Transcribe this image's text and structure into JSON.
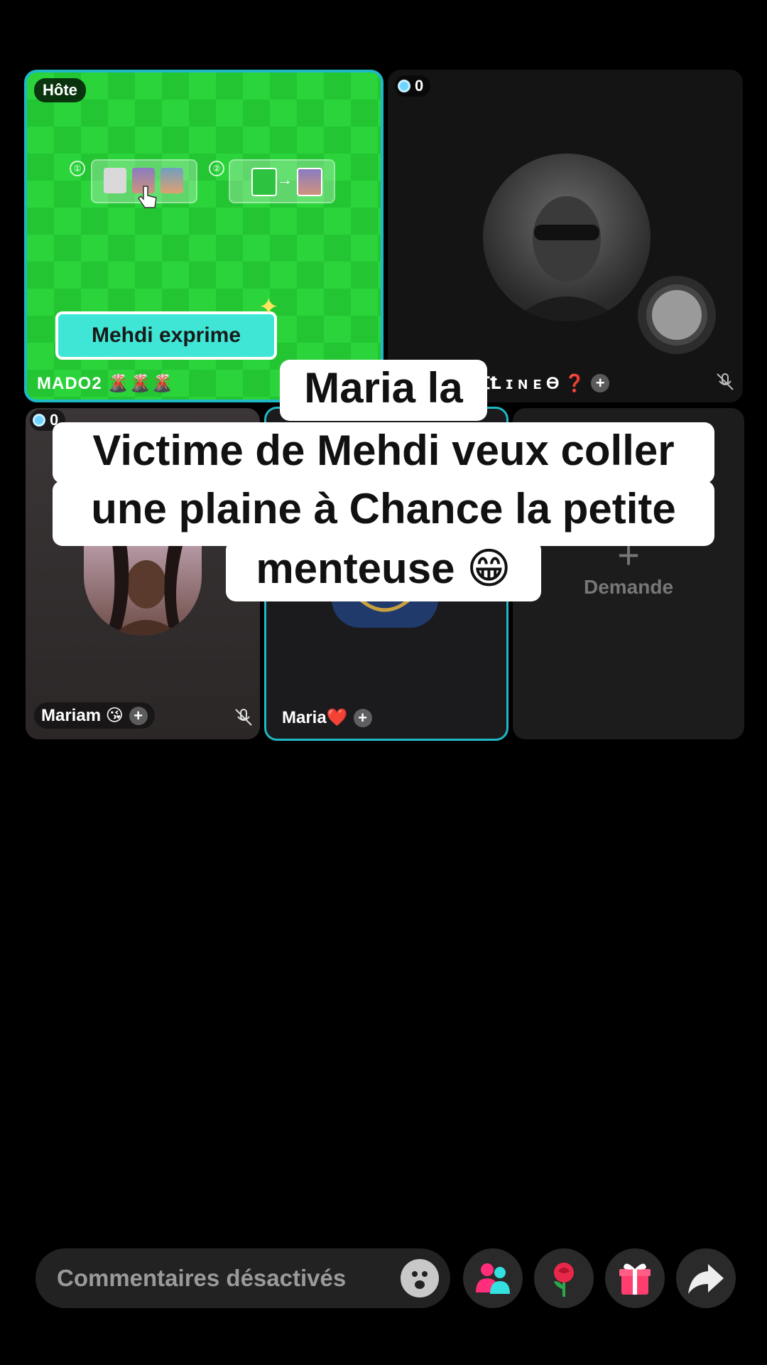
{
  "host_tile": {
    "badge": "Hôte",
    "effect_label": "Mehdi exprime",
    "name": "MADO2 🌋🌋🌋",
    "steps": [
      "①",
      "②"
    ]
  },
  "guest_tiles": [
    {
      "coins": "0",
      "name": "ꞮꝈ ɪ ɴ ᴇ ϴ ❓"
    },
    {
      "coins": "0",
      "name": "Mariam 😘"
    },
    {
      "name": "Maria❤️"
    },
    {
      "request_label": "Demande"
    }
  ],
  "caption": {
    "lines": [
      "Maria la",
      "Victime de Mehdi veux coller",
      "une plaine à Chance la petite",
      "menteuse 😁"
    ]
  },
  "bottom_bar": {
    "comment_placeholder": "Commentaires désactivés",
    "icons": [
      "emoji-icon",
      "guests-icon",
      "rose-gift-icon",
      "gift-icon",
      "share-icon"
    ]
  }
}
